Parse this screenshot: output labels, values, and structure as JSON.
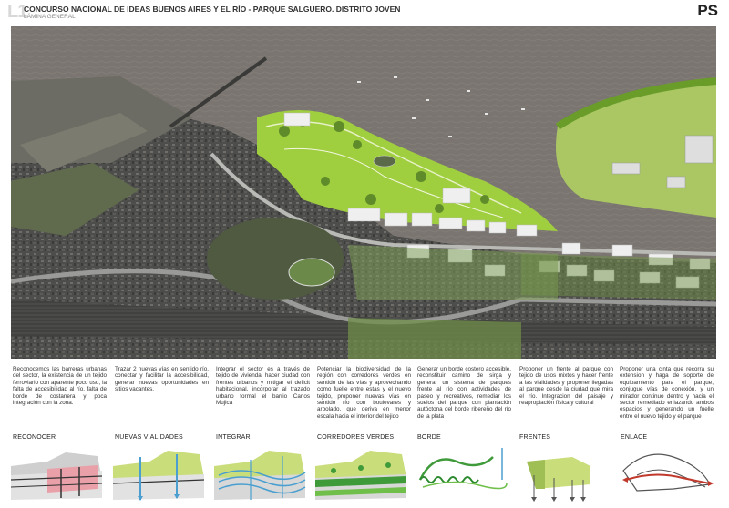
{
  "header": {
    "sheet": "L1",
    "title": "CONCURSO NACIONAL DE IDEAS BUENOS AIRES Y EL RÍO - PARQUE SALGUERO. DISTRITO JOVEN",
    "subtitle": "LÁMINA GENERAL",
    "logo": "PS"
  },
  "strategies": [
    {
      "label": "RECONOCER",
      "text": "Reconocemos las barreras urbanas del sector, la existencia de un tejido ferroviario con aparente poco uso, la falta de accesibilidad al río, falta de borde de costanera y poca integración con la zona."
    },
    {
      "label": "NUEVAS VIALIDADES",
      "text": "Trazar 2 nuevas vías en sentido río, conectar y facilitar la accesibilidad, generar nuevas oportunidades en sitios vacantes."
    },
    {
      "label": "INTEGRAR",
      "text": "Integrar el sector es a través de tejido de vivienda, hacer ciudad con frentes urbanos y mitigar el deficit habitacional, incorporar al trazado urbano formal el barrio Carlos Mujica"
    },
    {
      "label": "CORREDORES VERDES",
      "text": "Potenciar la biodiversidad de la región con corredores verdes en sentido de las vías y aprovechando como fuelle entre estas y el nuevo tejido, proponer nuevas vías en sentido río con boulevares y arbolado, que deriva en menor escala hacia el interior del tejido"
    },
    {
      "label": "BORDE",
      "text": "Generar un borde costero accesible, reconstituir camino de sirga y generar un sistema de parques frente al río con actividades de paseo y recreativos, remediar los suelos del parque con plantación autóctona del borde ribereño del río de la plata"
    },
    {
      "label": "FRENTES",
      "text": "Proponer un frente al parque con tejido de usos mixtos y hacer frente a las vialidades y proponer llegadas al parque desde la ciudad que mira el río. Integracion del paisaje y reapropiación física y cultural"
    },
    {
      "label": "ENLACE",
      "text": "Proponer una cinta que recorra su extension y haga de soporte de equipamiento para el parque, conjugue vías de conexión, y un mirador continuo dentro y hacia el sector remediado enlazando ambos espacios y generando un fuelle entre el nuevo tejido y el parque"
    }
  ],
  "colors": {
    "river": "#7b7570",
    "park_green": "#9fce3f",
    "city_gray": "#6a6a6a",
    "diagram_green": "#c9dd7a",
    "diagram_pink": "#e9a0a8",
    "diagram_blue": "#4a9fd0"
  }
}
